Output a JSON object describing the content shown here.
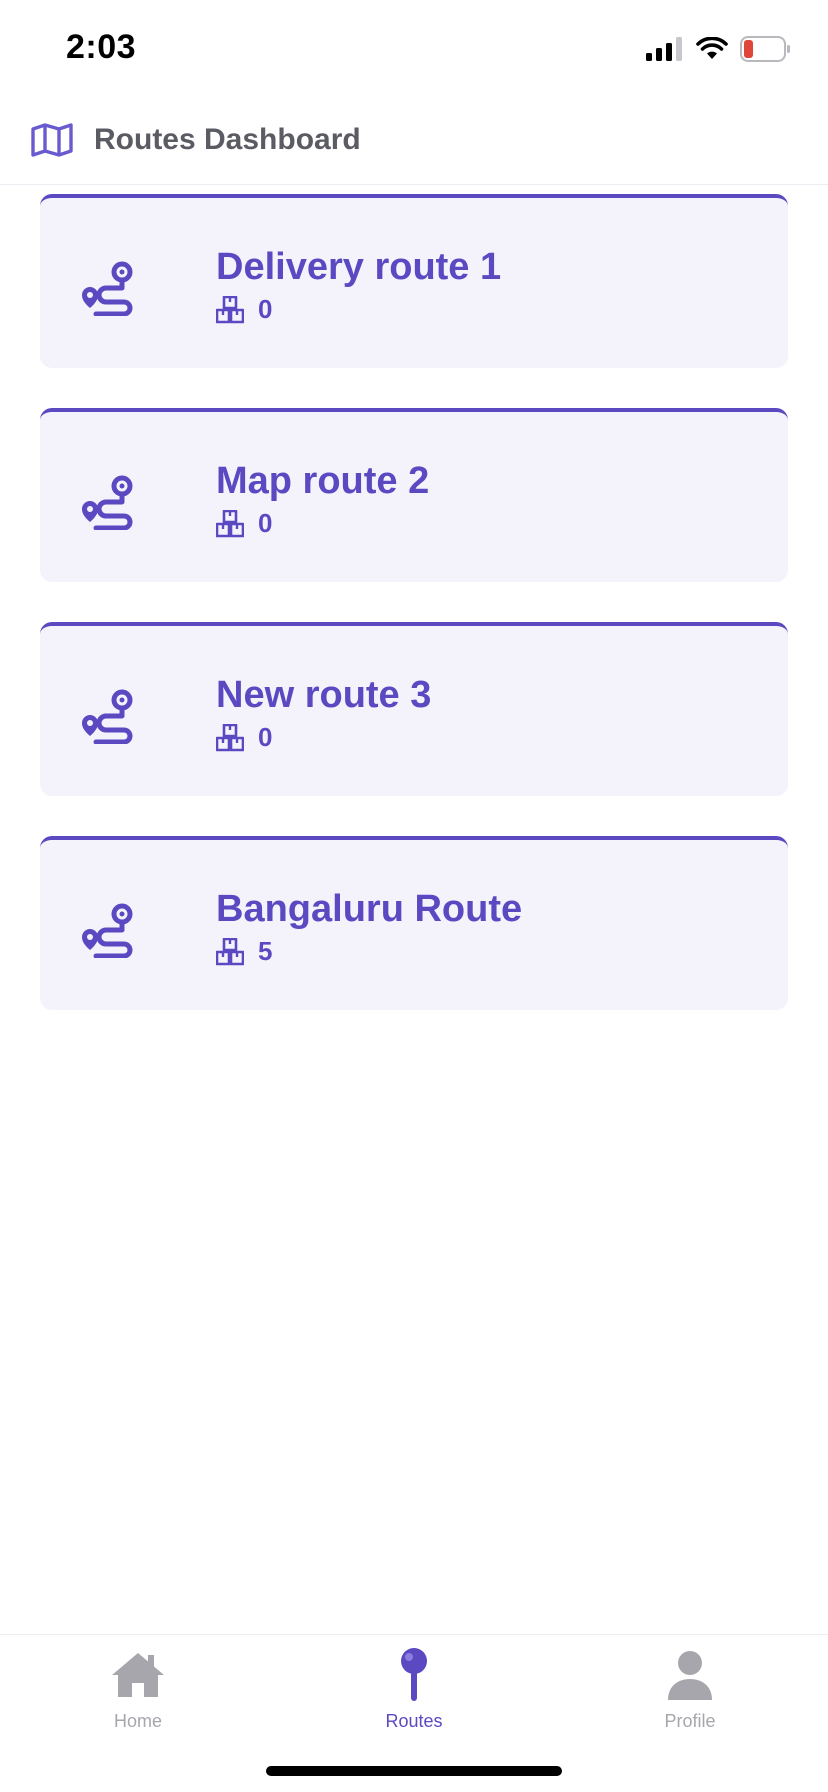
{
  "status_bar": {
    "time": "2:03"
  },
  "header": {
    "title": "Routes Dashboard",
    "icon": "map-icon"
  },
  "routes": [
    {
      "name": "Delivery route 1",
      "count": "0"
    },
    {
      "name": "Map route 2",
      "count": "0"
    },
    {
      "name": "New route 3",
      "count": "0"
    },
    {
      "name": "Bangaluru Route",
      "count": "5"
    }
  ],
  "tab_bar": {
    "tabs": [
      {
        "label": "Home",
        "icon": "home-icon",
        "active": false
      },
      {
        "label": "Routes",
        "icon": "pin-icon",
        "active": true
      },
      {
        "label": "Profile",
        "icon": "person-icon",
        "active": false
      }
    ]
  },
  "colors": {
    "accent": "#5b49c2",
    "card_bg": "#f4f3fc",
    "inactive": "#a6a6ac",
    "battery_low": "#e0453a"
  }
}
